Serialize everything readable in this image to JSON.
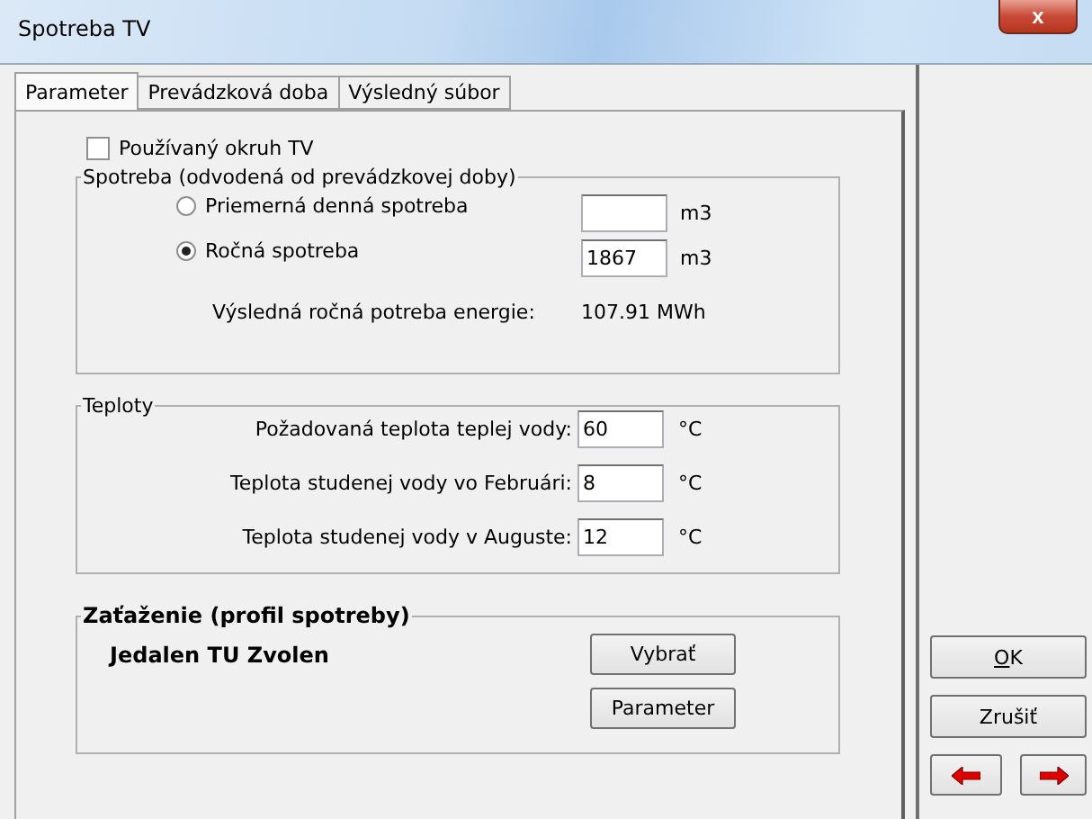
{
  "window": {
    "title": "Spotreba TV",
    "close": "x"
  },
  "tabs": [
    {
      "label": "Parameter",
      "selected": true
    },
    {
      "label": "Prevádzková doba",
      "selected": false
    },
    {
      "label": "Výsledný súbor",
      "selected": false
    }
  ],
  "used_circuit": {
    "label": "Používaný okruh TV",
    "checked": false
  },
  "consumption": {
    "title": "Spotreba (odvodená od prevádzkovej doby)",
    "options": [
      {
        "label": "Priemerná denná spotreba",
        "selected": false,
        "unit": "m3"
      },
      {
        "label": "Ročná spotreba",
        "selected": true,
        "value": "1867",
        "unit": "m3"
      }
    ],
    "result_label": "Výsledná ročná potreba energie:",
    "result_value": "107.91 MWh"
  },
  "temperatures": {
    "title": "Teploty",
    "rows": [
      {
        "label": "Požadovaná teplota teplej vody:",
        "value": "60",
        "unit": "°C"
      },
      {
        "label": "Teplota studenej vody vo Februári:",
        "value": "8",
        "unit": "°C"
      },
      {
        "label": "Teplota studenej vody v Auguste:",
        "value": "12",
        "unit": "°C"
      }
    ]
  },
  "load": {
    "title": "Zaťaženie (profil spotreby)",
    "profile": "Jedalen TU Zvolen",
    "buttons": [
      "Vybrať",
      "Parameter"
    ]
  },
  "buttons": [
    "OK",
    "Zrušiť"
  ]
}
